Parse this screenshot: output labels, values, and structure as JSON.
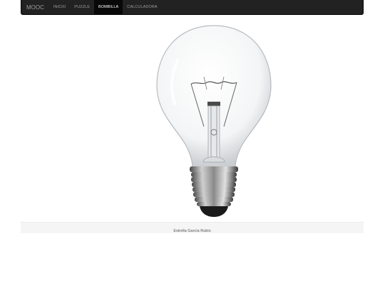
{
  "navbar": {
    "brand": "MOOC",
    "items": [
      {
        "label": "INICIO"
      },
      {
        "label": "PUZZLE"
      },
      {
        "label": "BOMBILLA"
      },
      {
        "label": "CALCULADORA"
      }
    ],
    "active_index": 2
  },
  "main": {
    "image_icon": "light-bulb-icon"
  },
  "footer": {
    "author": "Estrella García Rubio"
  },
  "colors": {
    "navbar_bg": "#222222",
    "nav_active_bg": "#080808",
    "footer_bg": "#f5f5f5"
  }
}
